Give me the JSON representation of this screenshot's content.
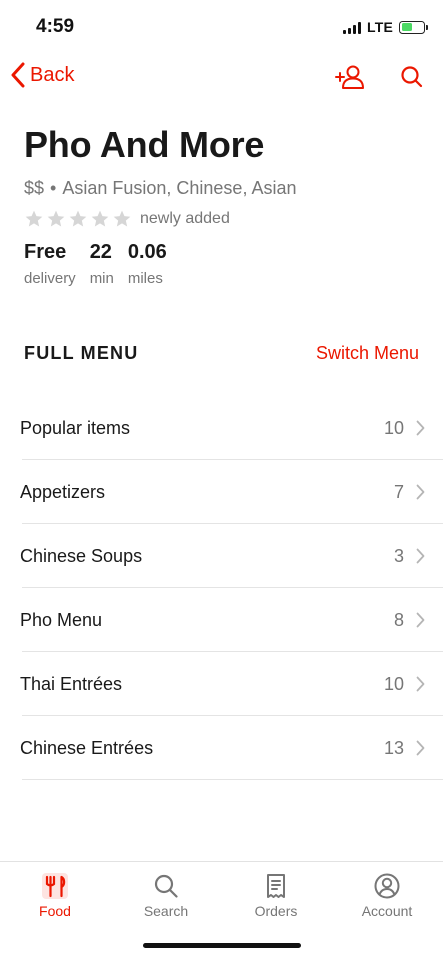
{
  "status_bar": {
    "time": "4:59",
    "network": "LTE"
  },
  "nav": {
    "back_label": "Back",
    "icons": [
      "group-order-icon",
      "search-icon"
    ]
  },
  "store": {
    "name": "Pho And More",
    "price_range": "$$",
    "separator": "•",
    "cuisines": "Asian Fusion, Chinese, Asian",
    "rating_stars": 0,
    "rating_text": "newly added",
    "stats": [
      {
        "value": "Free",
        "label": "delivery"
      },
      {
        "value": "22",
        "label": "min"
      },
      {
        "value": "0.06",
        "label": "miles"
      }
    ]
  },
  "menu": {
    "title": "FULL MENU",
    "switch_label": "Switch Menu",
    "categories": [
      {
        "name": "Popular items",
        "count": "10"
      },
      {
        "name": "Appetizers",
        "count": "7"
      },
      {
        "name": "Chinese Soups",
        "count": "3"
      },
      {
        "name": "Pho Menu",
        "count": "8"
      },
      {
        "name": "Thai Entrées",
        "count": "10"
      },
      {
        "name": "Chinese Entrées",
        "count": "13"
      }
    ]
  },
  "tab_bar": {
    "tabs": [
      {
        "label": "Food",
        "icon": "fork-knife-icon",
        "active": true
      },
      {
        "label": "Search",
        "icon": "search-icon",
        "active": false
      },
      {
        "label": "Orders",
        "icon": "receipt-icon",
        "active": false
      },
      {
        "label": "Account",
        "icon": "account-icon",
        "active": false
      }
    ]
  },
  "colors": {
    "accent": "#eb1700",
    "text_primary": "#191919",
    "text_secondary": "#767676",
    "star_empty": "#d6d6d6",
    "battery": "#4cd964"
  }
}
